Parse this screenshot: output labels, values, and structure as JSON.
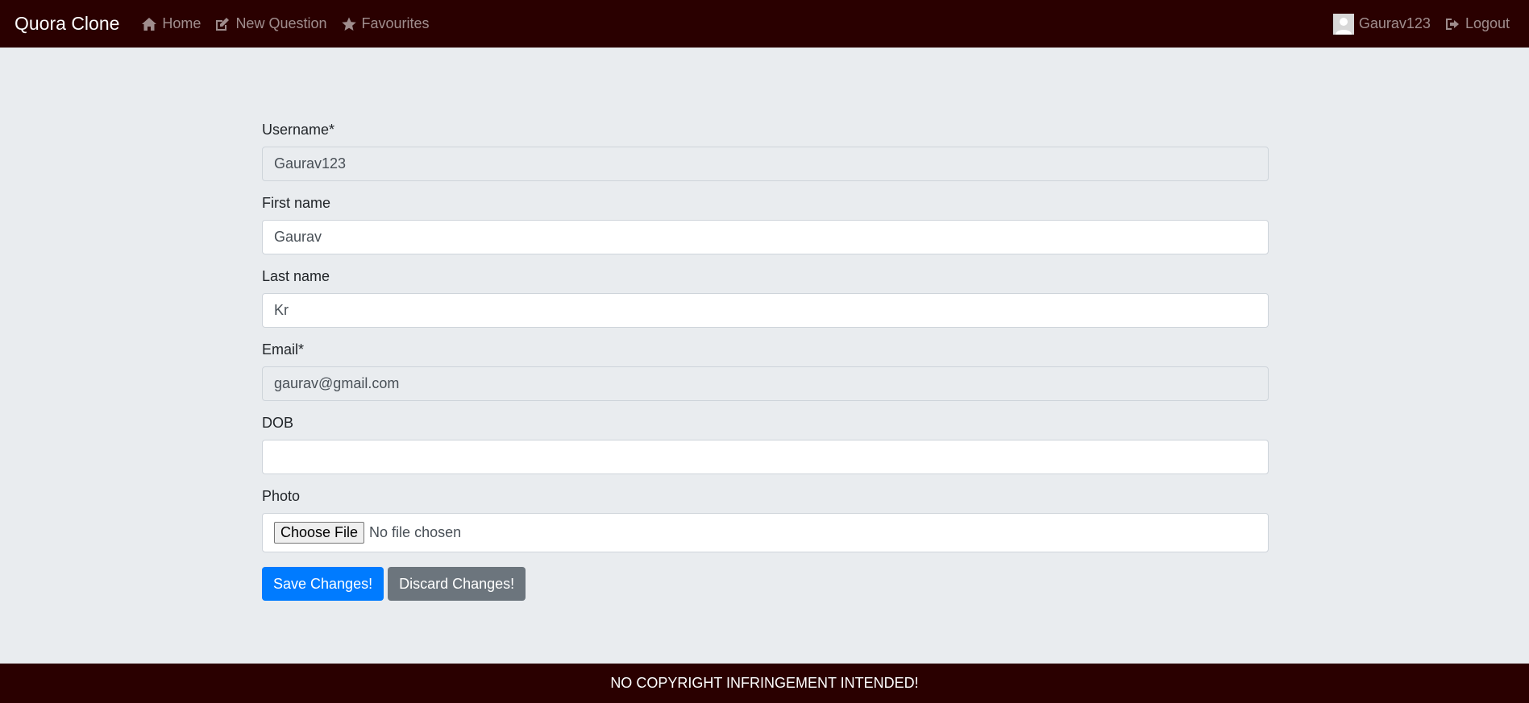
{
  "navbar": {
    "brand": "Quora Clone",
    "links": [
      {
        "label": "Home",
        "icon": "home-icon"
      },
      {
        "label": "New Question",
        "icon": "edit-icon"
      },
      {
        "label": "Favourites",
        "icon": "star-icon"
      }
    ],
    "user": {
      "label": "Gaurav123",
      "icon": "avatar"
    },
    "logout": {
      "label": "Logout",
      "icon": "sign-out-icon"
    }
  },
  "form": {
    "username": {
      "label": "Username*",
      "value": "Gaurav123"
    },
    "first_name": {
      "label": "First name",
      "value": "Gaurav"
    },
    "last_name": {
      "label": "Last name",
      "value": "Kr"
    },
    "email": {
      "label": "Email*",
      "value": "gaurav@gmail.com"
    },
    "dob": {
      "label": "DOB",
      "value": ""
    },
    "photo": {
      "label": "Photo",
      "button": "Choose File",
      "status": "No file chosen"
    }
  },
  "buttons": {
    "save": "Save Changes!",
    "discard": "Discard Changes!"
  },
  "footer": {
    "text": "NO COPYRIGHT INFRINGEMENT INTENDED!"
  },
  "colors": {
    "navbar_bg": "#2a0000",
    "page_bg": "#e9ecef",
    "primary": "#007bff",
    "secondary": "#6c757d"
  }
}
